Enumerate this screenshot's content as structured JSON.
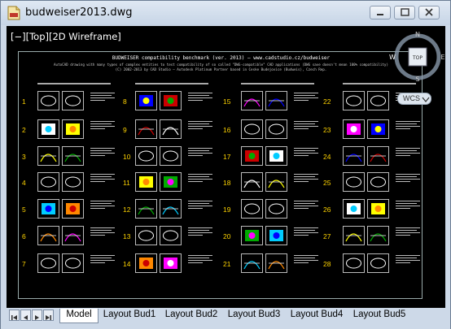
{
  "window": {
    "title": "budweiser2013.dwg"
  },
  "viewport": {
    "label": "[−][Top][2D Wireframe]"
  },
  "sheet": {
    "title": "BUDWEISER compatibility benchmark (ver. 2013) – www.cadstudio.cz/budweiser",
    "subtitle1": "AutoCAD drawing with many types of complex entities to test compatibility of so called \"DWG-compatible\" CAD applications (DWG save doesn't mean 100% compatibility)",
    "subtitle2": "(C) 2002-2013 by CAD Studio – Autodesk Platinum Partner based in Ceske Budejovice (Budweis), Czech Rep."
  },
  "navcube": {
    "north": "N",
    "south": "S",
    "east": "E",
    "west": "W",
    "face": "TOP"
  },
  "wcs": {
    "label": "WCS"
  },
  "cells": {
    "col1": [
      "1",
      "2",
      "3",
      "4",
      "5",
      "6",
      "7"
    ],
    "col2": [
      "8",
      "9",
      "10",
      "11",
      "12",
      "13",
      "14"
    ],
    "col3": [
      "15",
      "16",
      "17",
      "18",
      "19",
      "20",
      "21"
    ],
    "col4": [
      "22",
      "23",
      "24",
      "25",
      "26",
      "27",
      "28"
    ]
  },
  "tabs": [
    "Model",
    "Layout Bud1",
    "Layout Bud2",
    "Layout Bud3",
    "Layout Bud4",
    "Layout Bud5"
  ],
  "colors": {
    "canvas": "#000000",
    "number": "#ffd400",
    "chrome": "#cdd9e8"
  }
}
